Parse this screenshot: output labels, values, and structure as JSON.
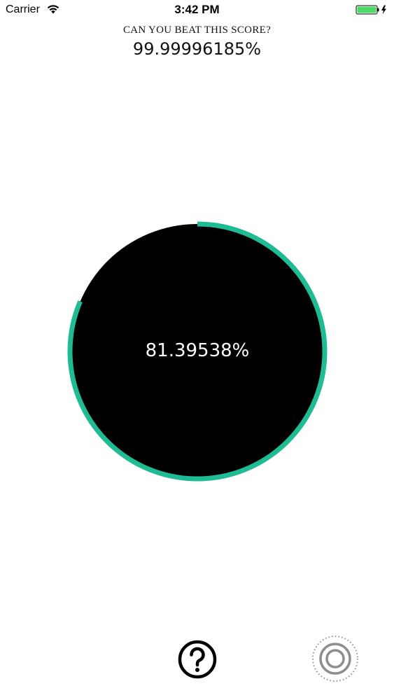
{
  "status_bar": {
    "carrier": "Carrier",
    "time": "3:42 PM",
    "battery_color": "#4cd964"
  },
  "header": {
    "challenge_label": "CAN YOU BEAT THIS SCORE?",
    "best_score": "99.99996185%"
  },
  "main": {
    "current_score": "81.39538%",
    "ring_progress_percent": 81.4,
    "ring_color": "#1fbc94",
    "circle_color": "#000000"
  },
  "bottom": {
    "help_icon": "question-mark-circle-icon",
    "target_icon": "concentric-target-icon"
  }
}
